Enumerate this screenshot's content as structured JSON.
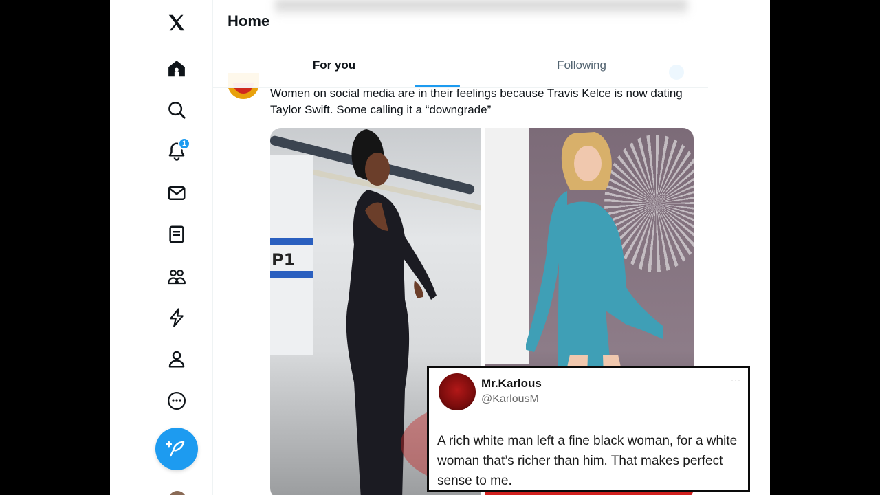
{
  "nav": {
    "logo": "x-logo-icon",
    "items": [
      {
        "name": "home",
        "icon": "home-icon"
      },
      {
        "name": "explore",
        "icon": "search-icon"
      },
      {
        "name": "notifications",
        "icon": "bell-icon",
        "badge": "1"
      },
      {
        "name": "messages",
        "icon": "mail-icon"
      },
      {
        "name": "lists",
        "icon": "list-icon"
      },
      {
        "name": "communities",
        "icon": "people-icon"
      },
      {
        "name": "premium",
        "icon": "bolt-icon"
      },
      {
        "name": "profile",
        "icon": "person-icon"
      },
      {
        "name": "more",
        "icon": "more-icon"
      }
    ],
    "post_icon": "compose-feather-icon"
  },
  "header": {
    "title": "Home"
  },
  "tabs": [
    {
      "label": "For you",
      "active": true
    },
    {
      "label": "Following",
      "active": false
    }
  ],
  "tweet": {
    "text": "Women on social media are in their feelings because Travis Kelce is now dating Taylor Swift. Some calling it a “downgrade”"
  },
  "quote_card": {
    "name": "Mr.Karlous",
    "handle": "@KarlousM",
    "more": "···",
    "text": "A rich white man left a fine black woman, for a white woman that’s richer than him. That makes perfect sense to me."
  },
  "media": {
    "left_photo_sign": "P1"
  },
  "colors": {
    "accent": "#1d9bf0",
    "text": "#0f1419",
    "muted": "#536471"
  }
}
